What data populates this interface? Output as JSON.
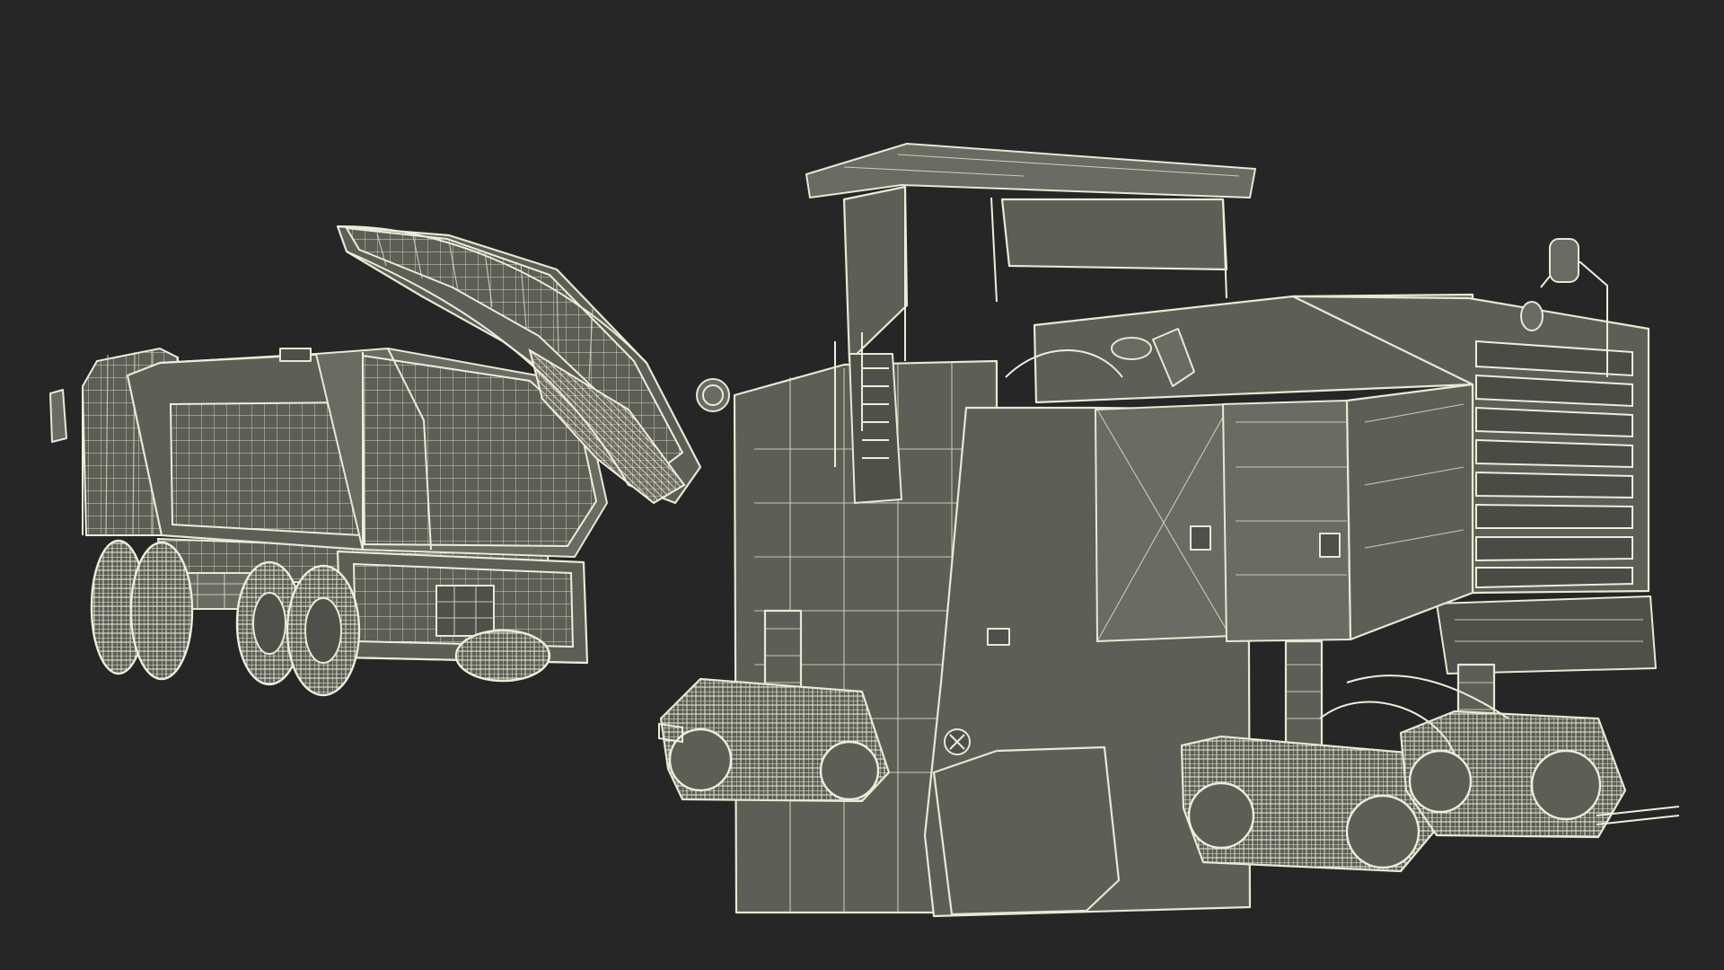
{
  "scene": {
    "background_color": "#262626",
    "wire_color": "#e9e8d4",
    "surface_color": "#5d5e56",
    "subjects": [
      {
        "kind": "cold-milling-machine"
      },
      {
        "kind": "dump-truck"
      }
    ]
  }
}
